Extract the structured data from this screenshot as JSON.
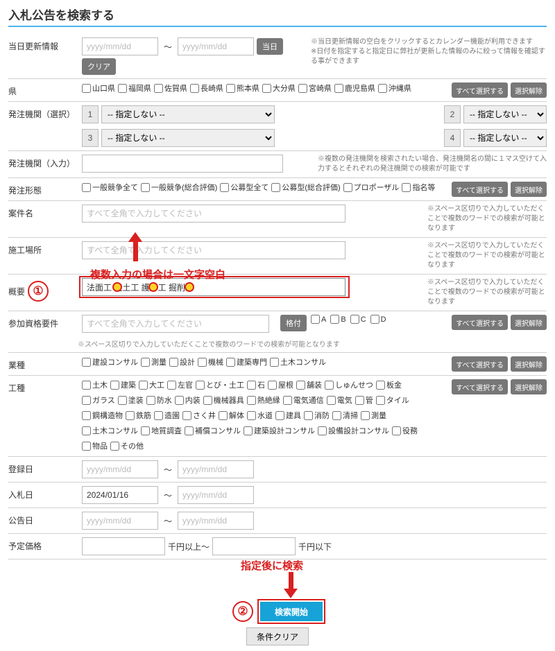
{
  "title": "入札公告を検索する",
  "labels": {
    "update": "当日更新情報",
    "pref": "県",
    "orderer_sel": "発注機関（選択）",
    "orderer_in": "発注機関（入力）",
    "form": "発注形態",
    "name": "案件名",
    "place": "施工場所",
    "overview": "概要",
    "qual": "参加資格要件",
    "industry": "業種",
    "work": "工種",
    "reg": "登録日",
    "bid": "入札日",
    "notice": "公告日",
    "price": "予定価格"
  },
  "ph": {
    "date": "yyyy/mm/dd",
    "zen": "すべて全角で入力してください"
  },
  "overview_value": "法面工 盛土工 護岸工 掘削工",
  "bid_from": "2024/01/16",
  "bid_to": "",
  "btn": {
    "today": "当日",
    "clear": "クリア",
    "sel_all": "すべて選択する",
    "desel": "選択解除",
    "search": "検索開始",
    "cond_clear": "条件クリア",
    "rating": "格付"
  },
  "hints": {
    "update": "※当日更新情報の空白をクリックするとカレンダー機能が利用できます\n※日付を指定すると指定日に弊社が更新した情報のみに絞って情報を確認する事ができます",
    "orderer_in": "※複数の発注機関を検索されたい場合、発注機関名の間に１マス空けて入力するとそれぞれの発注機関での検索が可能です",
    "multi": "※スペース区切りで入力していただくことで複数のワードでの検索が可能となります",
    "qual_small": "※スペース区切りで入力していただくことで複数のワードでの検索が可能となります"
  },
  "annot": {
    "multi": "複数入力の場合は一文字空白",
    "after": "指定後に検索"
  },
  "prefs": [
    "山口県",
    "福岡県",
    "佐賀県",
    "長崎県",
    "熊本県",
    "大分県",
    "宮崎県",
    "鹿児島県",
    "沖縄県"
  ],
  "orderer_opt": "-- 指定しない --",
  "forms": [
    "一般競争全て",
    "一般競争(総合評価)",
    "公募型全て",
    "公募型(総合評価)",
    "プロポーザル",
    "指名等"
  ],
  "grades": [
    "A",
    "B",
    "C",
    "D"
  ],
  "industries": [
    "建設コンサル",
    "測量",
    "設計",
    "機械",
    "建築専門",
    "土木コンサル"
  ],
  "works_row1": [
    "土木",
    "建築",
    "大工",
    "左官",
    "とび・土工",
    "石",
    "屋根",
    "舗装",
    "しゅんせつ",
    "板金"
  ],
  "works_row2": [
    "ガラス",
    "塗装",
    "防水",
    "内装",
    "機械器具",
    "熱絶縁",
    "電気通信",
    "電気",
    "管",
    "タイル"
  ],
  "works_row3": [
    "鋼構造物",
    "鉄筋",
    "造園",
    "さく井",
    "解体",
    "水道",
    "建具",
    "消防",
    "清掃",
    "測量"
  ],
  "works_row4": [
    "土木コンサル",
    "地質調査",
    "補償コンサル",
    "建築設計コンサル",
    "設備設計コンサル",
    "役務"
  ],
  "works_row5": [
    "物品",
    "その他"
  ],
  "price_from": "千円以上～",
  "price_to": "千円以下"
}
